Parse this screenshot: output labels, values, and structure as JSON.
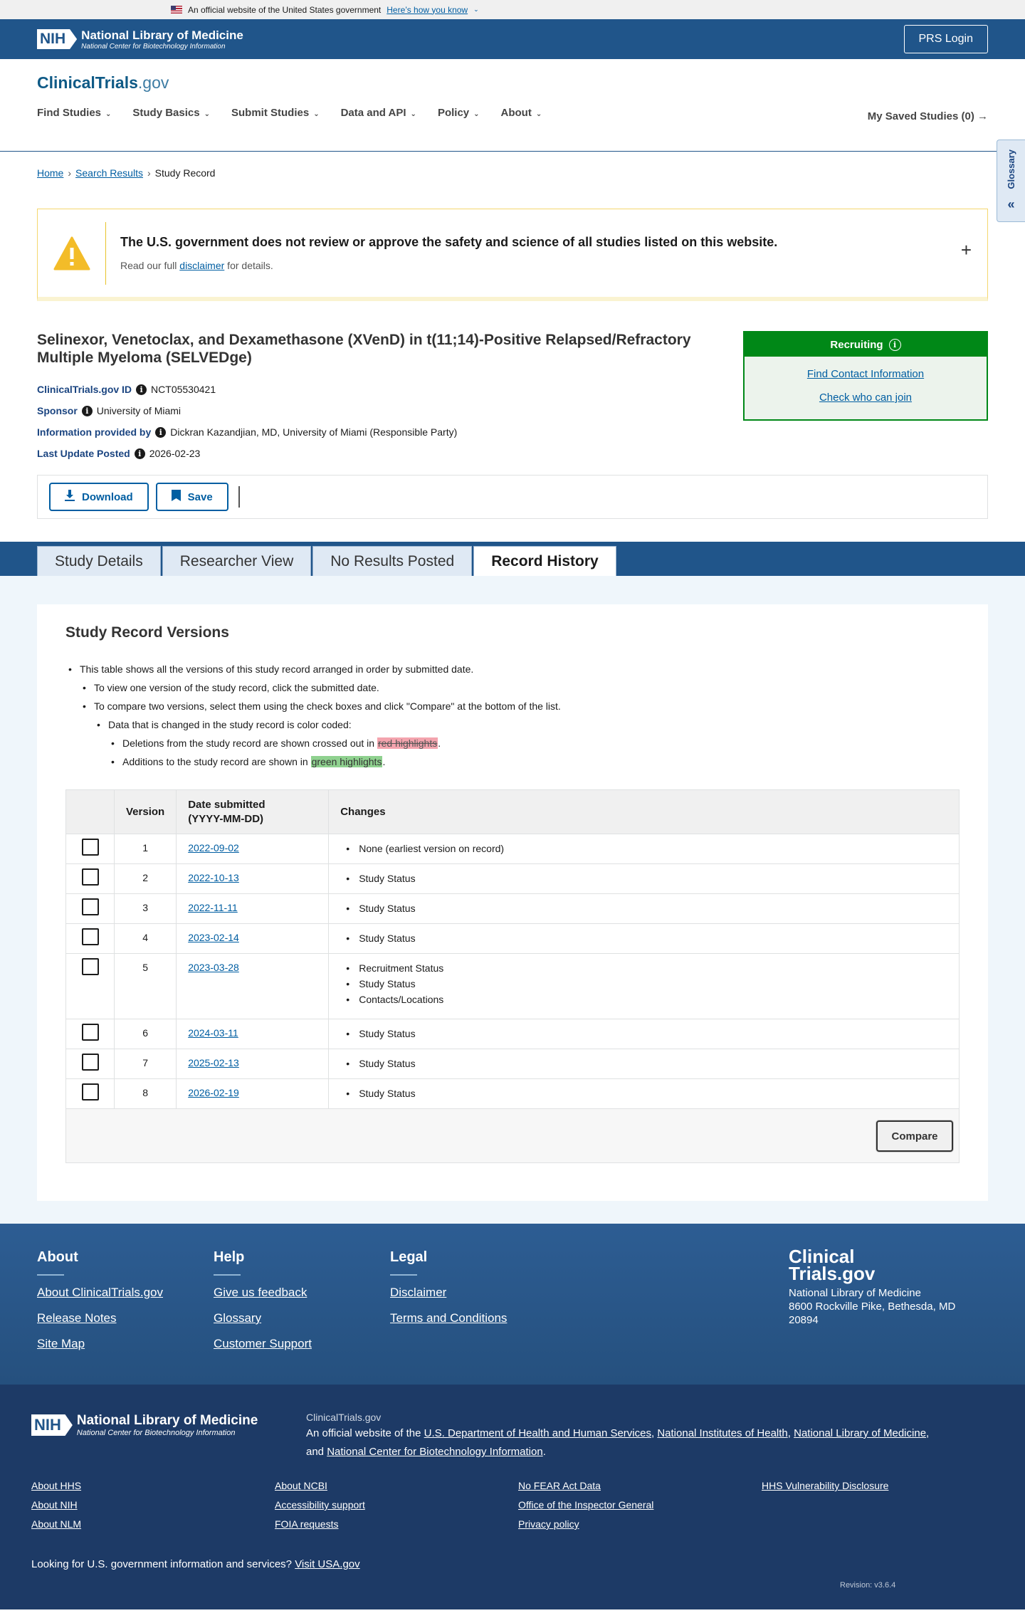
{
  "gov_banner": {
    "text": "An official website of the United States government",
    "link": "Here’s how you know"
  },
  "nih": {
    "abbr": "NIH",
    "name": "National Library of Medicine",
    "sub": "National Center for Biotechnology Information"
  },
  "prs_login": "PRS Login",
  "site": {
    "title_a": "ClinicalTrials",
    "title_b": ".gov"
  },
  "nav": [
    "Find Studies",
    "Study Basics",
    "Submit Studies",
    "Data and API",
    "Policy",
    "About"
  ],
  "saved": "My Saved Studies (0)",
  "glossary": "Glossary",
  "breadcrumb": {
    "home": "Home",
    "search": "Search Results",
    "current": "Study Record"
  },
  "alert": {
    "title": "The U.S. government does not review or approve the safety and science of all studies listed on this website.",
    "pre": "Read our full ",
    "link": "disclaimer",
    "post": " for details.",
    "toggle": "+"
  },
  "study": {
    "title": "Selinexor, Venetoclax, and Dexamethasone (XVenD) in t(11;14)-Positive Relapsed/Refractory Multiple Myeloma (SELVEDge)",
    "id_label": "ClinicalTrials.gov ID",
    "id": "NCT05530421",
    "sponsor_label": "Sponsor",
    "sponsor": "University of Miami",
    "provider_label": "Information provided by",
    "provider": "Dickran Kazandjian, MD, University of Miami (Responsible Party)",
    "update_label": "Last Update Posted",
    "update": "2026-02-23"
  },
  "status": {
    "label": "Recruiting",
    "contact": "Find Contact Information",
    "join": "Check who can join",
    "color": "#008817"
  },
  "actions": {
    "download": "Download",
    "save": "Save"
  },
  "tabs": [
    "Study Details",
    "Researcher View",
    "No Results Posted",
    "Record History"
  ],
  "versions": {
    "heading": "Study Record Versions",
    "info1": "This table shows all the versions of this study record arranged in order by submitted date.",
    "info2": "To view one version of the study record, click the submitted date.",
    "info3": "To compare two versions, select them using the check boxes and click \"Compare\" at the bottom of the list.",
    "info4": "Data that is changed in the study record is color coded:",
    "del_pre": "Deletions from the study record are shown crossed out in ",
    "del_hl": "red highlights",
    "del_post": ".",
    "add_pre": "Additions to the study record are shown in ",
    "add_hl": "green highlights",
    "add_post": ".",
    "col_version": "Version",
    "col_date": "Date submitted (YYYY-MM-DD)",
    "col_changes": "Changes",
    "rows": [
      {
        "v": "1",
        "date": "2022-09-02",
        "changes": [
          "None (earliest version on record)"
        ]
      },
      {
        "v": "2",
        "date": "2022-10-13",
        "changes": [
          "Study Status"
        ]
      },
      {
        "v": "3",
        "date": "2022-11-11",
        "changes": [
          "Study Status"
        ]
      },
      {
        "v": "4",
        "date": "2023-02-14",
        "changes": [
          "Study Status"
        ]
      },
      {
        "v": "5",
        "date": "2023-03-28",
        "changes": [
          "Recruitment Status",
          "Study Status",
          "Contacts/Locations"
        ]
      },
      {
        "v": "6",
        "date": "2024-03-11",
        "changes": [
          "Study Status"
        ]
      },
      {
        "v": "7",
        "date": "2025-02-13",
        "changes": [
          "Study Status"
        ]
      },
      {
        "v": "8",
        "date": "2026-02-19",
        "changes": [
          "Study Status"
        ]
      }
    ],
    "compare": "Compare"
  },
  "footer": {
    "about": {
      "h": "About",
      "links": [
        "About ClinicalTrials.gov",
        "Release Notes",
        "Site Map"
      ]
    },
    "help": {
      "h": "Help",
      "links": [
        "Give us feedback",
        "Glossary",
        "Customer Support"
      ]
    },
    "legal": {
      "h": "Legal",
      "links": [
        "Disclaimer",
        "Terms and Conditions"
      ]
    },
    "logo_a": "Clinical",
    "logo_b": "Trials.gov",
    "org": "National Library of Medicine",
    "addr": "8600 Rockville Pike, Bethesda, MD 20894"
  },
  "bottom": {
    "ctg": "ClinicalTrials.gov",
    "official_pre": "An official website of the ",
    "hhs": "U.S. Department of Health and Human Services",
    "nih": "National Institutes of Health",
    "nlm": "National Library of Medicine",
    "and": "and ",
    "ncbi": "National Center for Biotechnology Information",
    "col1": [
      "About HHS",
      "About NIH",
      "About NLM"
    ],
    "col2": [
      "About NCBI",
      "Accessibility support",
      "FOIA requests"
    ],
    "col3": [
      "No FEAR Act Data",
      "Office of the Inspector General",
      "Privacy policy"
    ],
    "col4": [
      "HHS Vulnerability Disclosure"
    ],
    "usa_pre": "Looking for U.S. government information and services? ",
    "usa_link": "Visit USA.gov",
    "revision": "Revision: v3.6.4"
  }
}
